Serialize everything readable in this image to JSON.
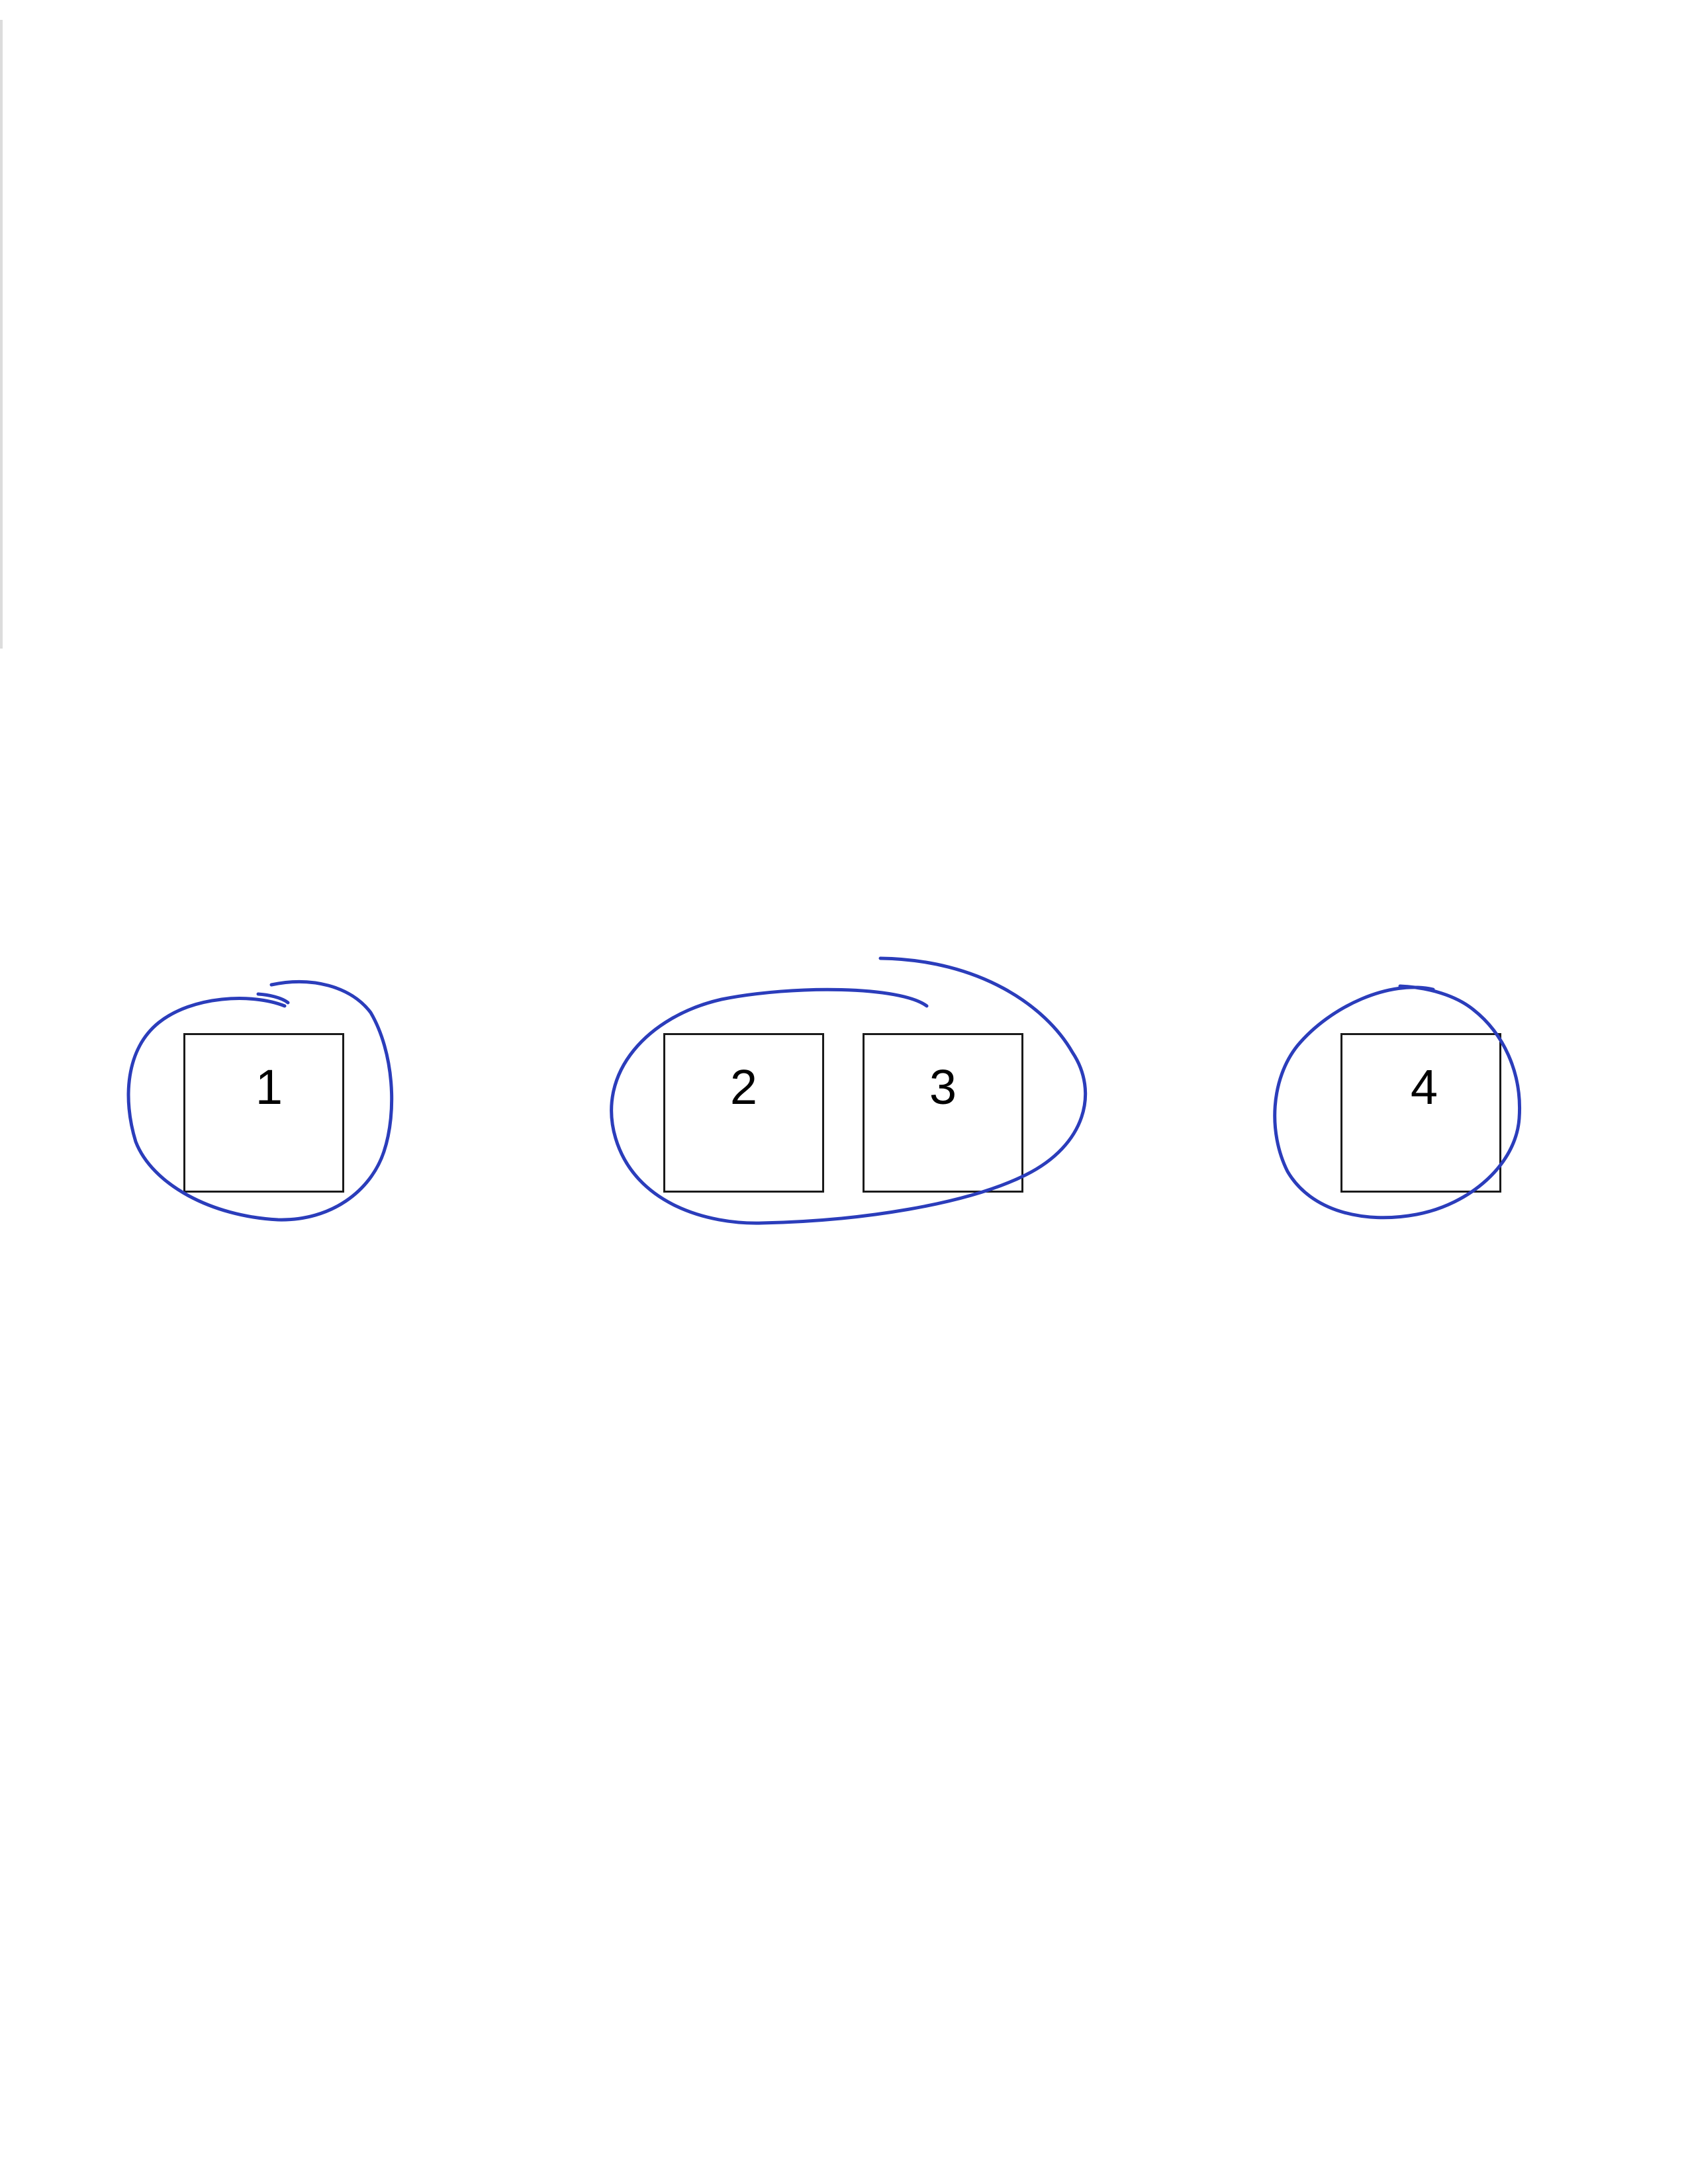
{
  "diagram": {
    "ink_color": "#2b3dbb",
    "box_border_color": "#1a1a1a",
    "boxes": [
      {
        "label": "1"
      },
      {
        "label": "2"
      },
      {
        "label": "3"
      },
      {
        "label": "4"
      }
    ],
    "groups": [
      {
        "members": [
          "1"
        ]
      },
      {
        "members": [
          "2",
          "3"
        ]
      },
      {
        "members": [
          "4"
        ]
      }
    ]
  }
}
